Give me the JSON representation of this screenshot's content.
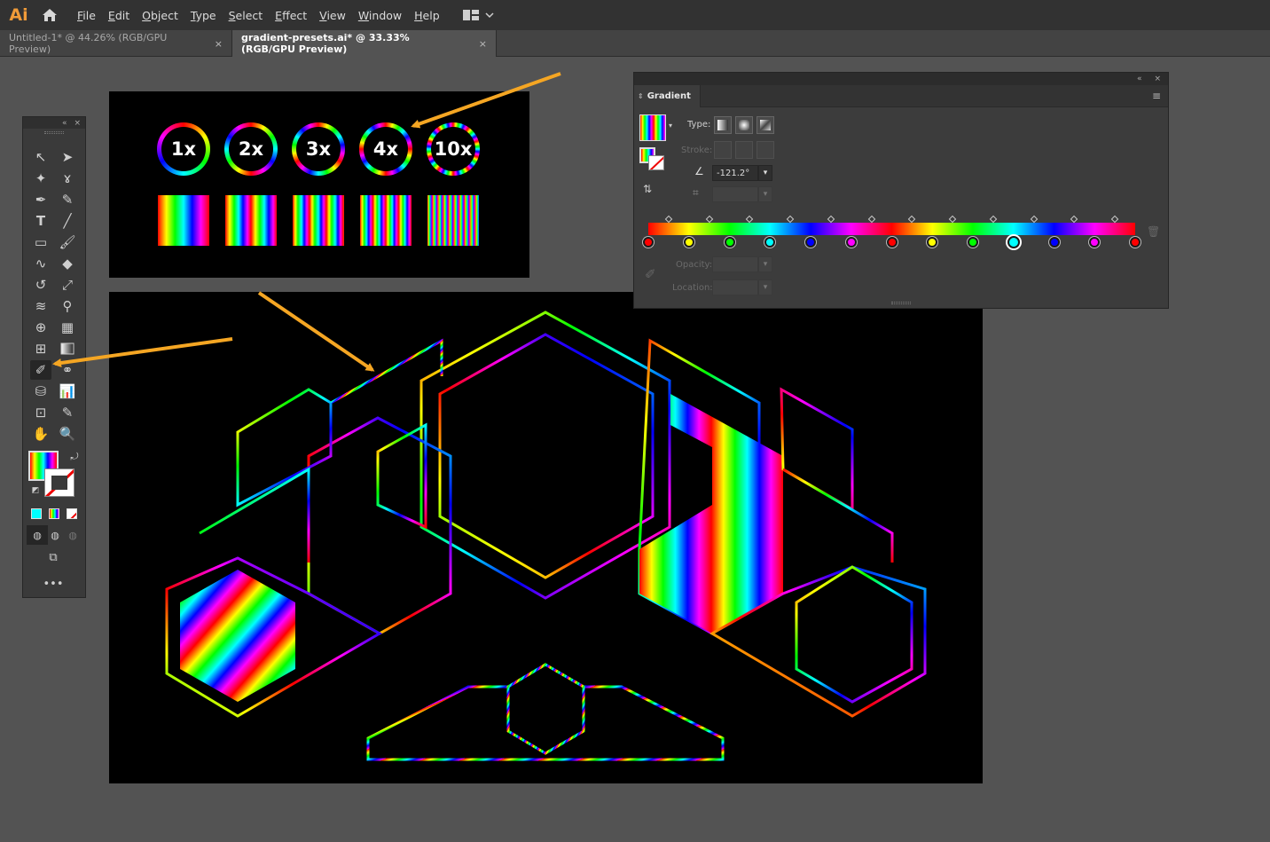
{
  "app": {
    "logo": "Ai"
  },
  "menu": [
    "File",
    "Edit",
    "Object",
    "Type",
    "Select",
    "Effect",
    "View",
    "Window",
    "Help"
  ],
  "tabs": [
    {
      "label": "Untitled-1* @ 44.26% (RGB/GPU Preview)",
      "close": "×",
      "active": false
    },
    {
      "label": "gradient-presets.ai* @ 33.33% (RGB/GPU Preview)",
      "close": "×",
      "active": true
    }
  ],
  "rings": [
    "1x",
    "2x",
    "3x",
    "4x",
    "10x"
  ],
  "gradient_panel": {
    "title": "Gradient",
    "type_label": "Type:",
    "stroke_label": "Stroke:",
    "angle": "-121.2°",
    "opacity_label": "Opacity:",
    "location_label": "Location:",
    "stops": [
      "#ff0000",
      "#ffff00",
      "#00ff00",
      "#00ffff",
      "#0000ff",
      "#ff00ff",
      "#ff0000",
      "#ffff00",
      "#00ff00",
      "#00ffff",
      "#0000ff",
      "#ff00ff",
      "#ff0000"
    ],
    "selected_stop": 9
  },
  "colors": {
    "accent_arrow": "#f5a623",
    "app_orange": "#f09b39",
    "spectrum": [
      "#ff0000",
      "#ffff00",
      "#00ff00",
      "#00ffff",
      "#0000ff",
      "#ff00ff",
      "#ff0000"
    ]
  },
  "icons": {
    "menu_home": "home-icon",
    "workspace": "workspace-switcher-icon"
  }
}
